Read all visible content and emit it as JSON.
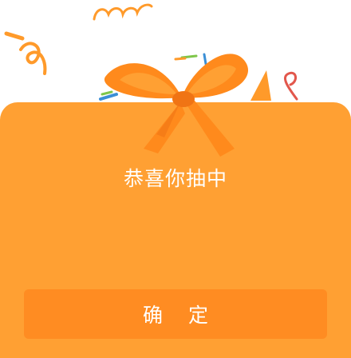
{
  "dialog": {
    "title": "恭喜你抽中",
    "confirm_label": "确 定"
  },
  "colors": {
    "card": "#ffa033",
    "button": "#ff8c22",
    "bow": "#ff8a1c",
    "bow_dark": "#f07414",
    "confetti_orange": "#ff9a2a",
    "confetti_green": "#7fc64a",
    "confetti_red": "#e2574c",
    "confetti_blue": "#3b8fd6"
  },
  "icons": [
    "gift-bow-icon",
    "confetti-icon"
  ]
}
